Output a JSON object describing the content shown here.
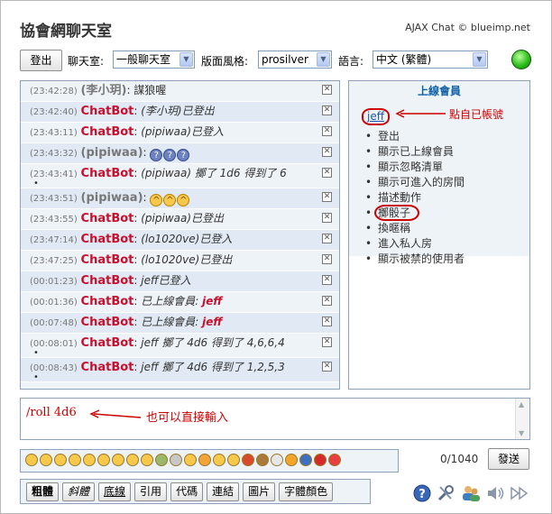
{
  "header": {
    "title": "協會網聊天室",
    "credit": "AJAX Chat © blueimp.net"
  },
  "toolbar": {
    "logout": "登出",
    "channel_label": "聊天室:",
    "channel_value": "一般聊天室",
    "style_label": "版面風格:",
    "style_value": "prosilver",
    "language_label": "語言:",
    "language_value": "中文 (繁體)"
  },
  "messages": [
    {
      "time": "(23:42:28)",
      "user": "(李小玥)",
      "is_bot": false,
      "text": "謀狼喔"
    },
    {
      "time": "(23:42:40)",
      "user": "ChatBot",
      "is_bot": true,
      "text": "(李小玥)已登出"
    },
    {
      "time": "(23:43:11)",
      "user": "ChatBot",
      "is_bot": true,
      "text": "(pipiwaa)已登入"
    },
    {
      "time": "(23:43:32)",
      "user": "(pipiwaa)",
      "is_bot": false,
      "text": "",
      "emoticons": [
        "?",
        "?",
        "?"
      ]
    },
    {
      "time": "(23:43:41)",
      "user": "ChatBot",
      "is_bot": true,
      "text": "(pipiwaa) 擲了 1d6 得到了 6"
    },
    {
      "time": "(23:43:51)",
      "user": "(pipiwaa)",
      "is_bot": false,
      "text": "",
      "emoticons": [
        "^",
        "^",
        "^"
      ]
    },
    {
      "time": "(23:43:55)",
      "user": "ChatBot",
      "is_bot": true,
      "text": "(pipiwaa)已登出"
    },
    {
      "time": "(23:47:14)",
      "user": "ChatBot",
      "is_bot": true,
      "text": "(lo1020ve)已登入"
    },
    {
      "time": "(23:47:25)",
      "user": "ChatBot",
      "is_bot": true,
      "text": "(lo1020ve)已登出"
    },
    {
      "time": "(00:01:23)",
      "user": "ChatBot",
      "is_bot": true,
      "text": "jeff已登入"
    },
    {
      "time": "(00:01:36)",
      "user": "ChatBot",
      "is_bot": true,
      "text": "已上線會員:",
      "highlight": "jeff"
    },
    {
      "time": "(00:07:48)",
      "user": "ChatBot",
      "is_bot": true,
      "text": "已上線會員:",
      "highlight": "jeff"
    },
    {
      "time": "(00:08:01)",
      "user": "ChatBot",
      "is_bot": true,
      "text": "jeff 擲了 4d6 得到了 4,6,6,4"
    },
    {
      "time": "(00:08:43)",
      "user": "ChatBot",
      "is_bot": true,
      "text": "jeff 擲了 4d6 得到了 1,2,5,3"
    }
  ],
  "online": {
    "title": "上線會員",
    "user": "jeff",
    "menu": [
      "登出",
      "顯示已上線會員",
      "顯示忽略清單",
      "顯示可進入的房間",
      "描述動作",
      "擲骰子",
      "換暱稱",
      "進入私人房",
      "顯示被禁的使用者"
    ]
  },
  "annotations": {
    "click_self": "點自已帳號",
    "type_directly": "也可以直接輸入"
  },
  "input": {
    "value": "/roll  4d6"
  },
  "counter": "0/1040",
  "send": "發送",
  "format": {
    "bold": "粗體",
    "italic": "斜體",
    "underline": "底線",
    "quote": "引用",
    "code": "代碼",
    "link": "連結",
    "image": "圖片",
    "color": "字體顏色"
  },
  "emoticon_count": 22,
  "colors": {
    "bot": "#c8102e",
    "accent": "#1060a8",
    "annotation": "#cc0000"
  }
}
